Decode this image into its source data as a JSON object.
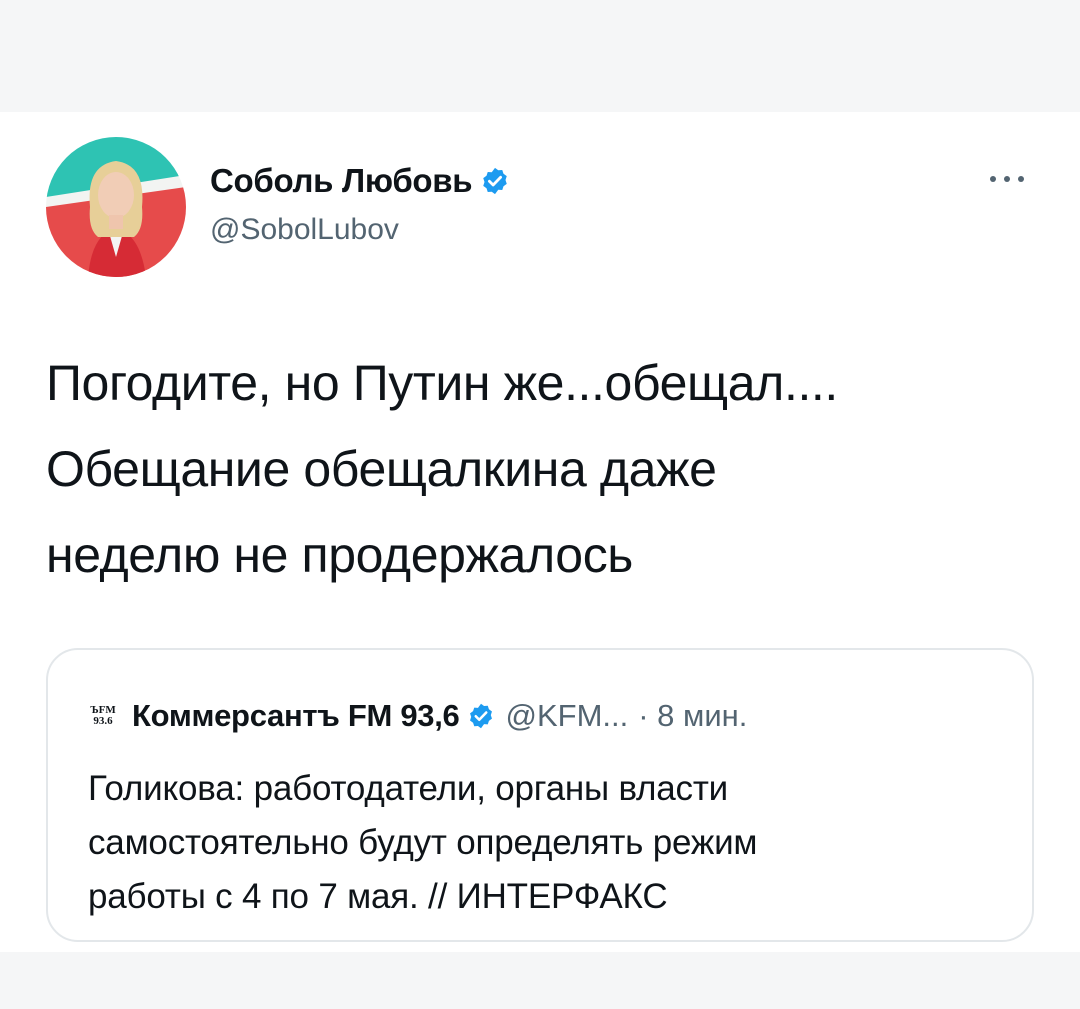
{
  "tweet": {
    "author": {
      "name": "Соболь Любовь",
      "handle": "@SobolLubov",
      "verified": true,
      "avatar_icon": "profile-photo"
    },
    "more_icon": "more-horizontal-icon",
    "text_lines": [
      "Погодите, но Путин же...обещал....",
      "Обещание обещалкина даже",
      "неделю не продержалось"
    ],
    "quoted": {
      "logo_lines": [
        "ЪFM",
        "93.6"
      ],
      "author": "Коммерсантъ FM 93,6",
      "verified": true,
      "handle": "@KFM...",
      "time": "· 8 мин.",
      "text_lines": [
        "Голикова: работодатели, органы власти",
        "самостоятельно будут определять режим",
        "работы с 4 по 7 мая. // ИНТЕРФАКС"
      ]
    }
  },
  "colors": {
    "verified": "#1d9bf0",
    "secondary_text": "#536471",
    "primary_text": "#0f1419",
    "border": "#e3e7ea",
    "band": "#f5f6f7"
  }
}
